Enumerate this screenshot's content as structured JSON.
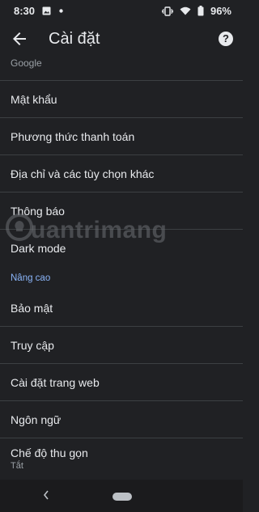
{
  "status": {
    "time": "8:30",
    "battery": "96%"
  },
  "header": {
    "title": "Cài đặt"
  },
  "list": {
    "google_section": "Google",
    "items": [
      "Mật khẩu",
      "Phương thức thanh toán",
      "Địa chỉ và các tùy chọn khác",
      "Thông báo",
      "Dark mode"
    ],
    "advanced_header": "Nâng cao",
    "advanced_items": [
      "Bảo mật",
      "Truy cập",
      "Cài đặt trang web",
      "Ngôn ngữ"
    ],
    "lite_mode": {
      "label": "Chế độ thu gọn",
      "value": "Tắt"
    }
  },
  "watermark": {
    "text": "uantrimang"
  },
  "colors": {
    "background": "#202124",
    "accent": "#8ab4f8",
    "divider": "#3c4043"
  }
}
